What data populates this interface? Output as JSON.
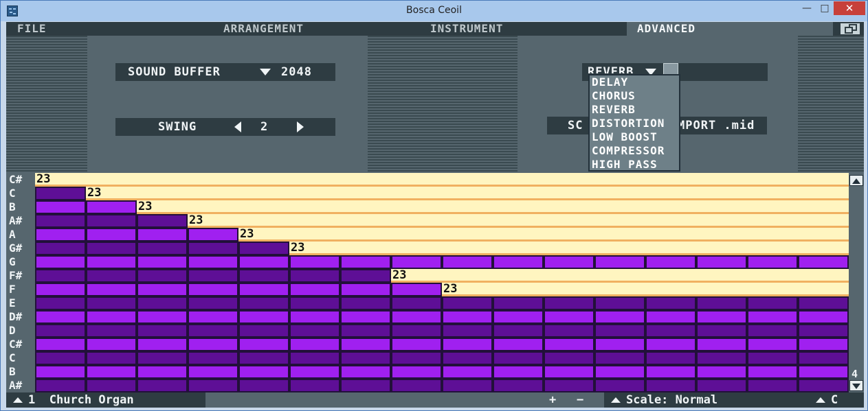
{
  "window": {
    "title": "Bosca Ceoil",
    "minimize": "—",
    "maximize": "□",
    "close": "✕"
  },
  "menu": {
    "file": "FILE",
    "arrangement": "ARRANGEMENT",
    "instrument": "INSTRUMENT",
    "advanced": "ADVANCED"
  },
  "advanced": {
    "sound_buffer_label": "SOUND BUFFER",
    "sound_buffer_value": "2048",
    "swing_label": "SWING",
    "swing_value": "2",
    "effect_selected": "REVERB",
    "export_partial_left": "SC",
    "export_partial_right": "MPORT .mid"
  },
  "effects_dropdown": [
    "DELAY",
    "CHORUS",
    "REVERB",
    "DISTORTION",
    "LOW BOOST",
    "COMPRESSOR",
    "HIGH PASS"
  ],
  "notes": [
    "C#",
    "C",
    "B",
    "A#",
    "A",
    "G#",
    "G",
    "F#",
    "F",
    "E",
    "D#",
    "D",
    "C#",
    "C",
    "B",
    "A#"
  ],
  "pattern_columns": 16,
  "note_value": "23",
  "highlight_notes": [
    {
      "note_index": 0,
      "column": 0,
      "value": "23"
    },
    {
      "note_index": 1,
      "column": 1,
      "value": "23"
    },
    {
      "note_index": 2,
      "column": 2,
      "value": "23"
    },
    {
      "note_index": 3,
      "column": 3,
      "value": "23"
    },
    {
      "note_index": 4,
      "column": 4,
      "value": "23"
    },
    {
      "note_index": 5,
      "column": 5,
      "value": "23"
    },
    {
      "note_index": 7,
      "column": 7,
      "value": "23"
    },
    {
      "note_index": 8,
      "column": 8,
      "value": "23"
    }
  ],
  "octave_marker": "4",
  "footer": {
    "instrument_number": "1",
    "instrument_name": "Church Organ",
    "add": "+",
    "remove": "−",
    "scale": "Scale: Normal",
    "key": "C"
  },
  "colors": {
    "note_bright": "#a020f0",
    "note_dark": "#5e0f96",
    "highlight": "#fff5c0",
    "highlight_border": "#f0b060",
    "menu_bg": "#2e3c42",
    "panel_bg": "#56666e"
  },
  "icons": {
    "app": "bosca-ceoil-icon",
    "restore": "restore-icon",
    "dropdown_arrow": "chevron-down-icon",
    "swing_left": "arrow-left-icon",
    "swing_right": "arrow-right-icon",
    "scroll_up": "scroll-up-icon",
    "scroll_down": "scroll-down-icon",
    "instrument_up": "triangle-up-icon",
    "scale_up": "triangle-up-icon",
    "key_up": "triangle-up-icon"
  }
}
